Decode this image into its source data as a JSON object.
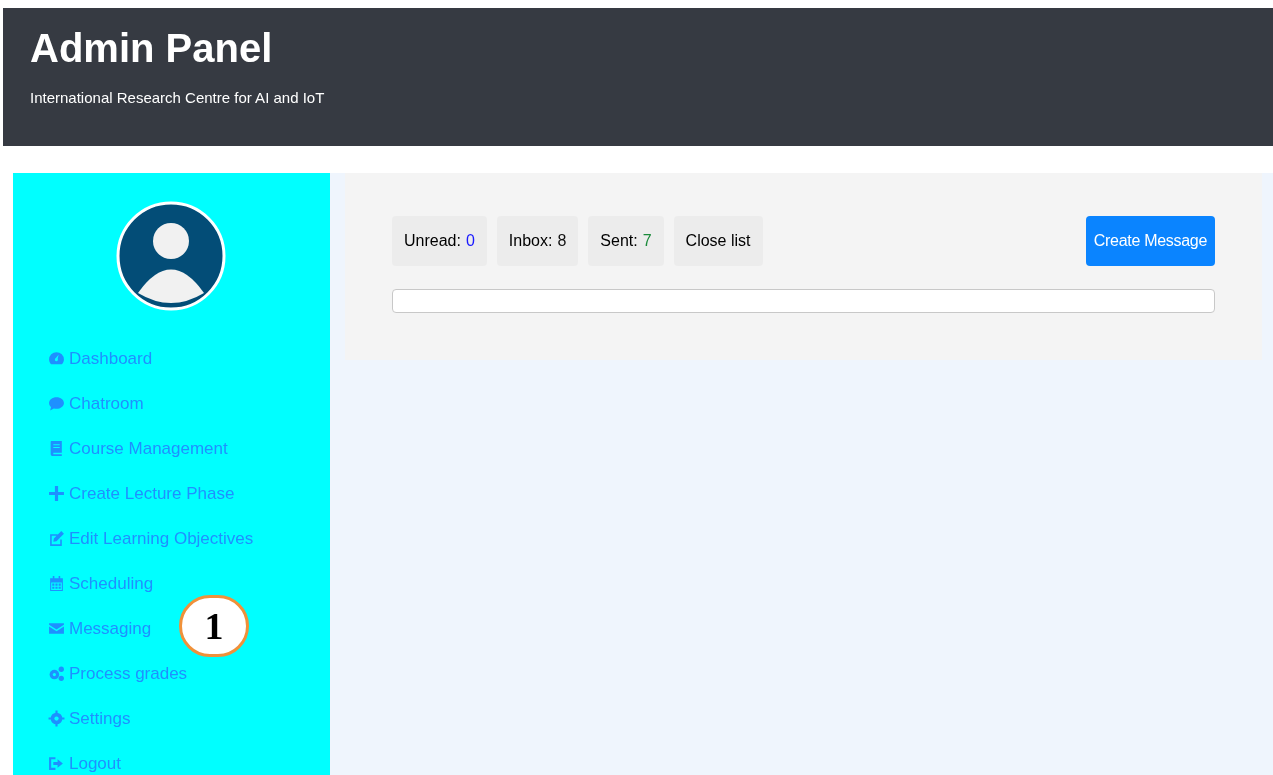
{
  "header": {
    "title": "Admin Panel",
    "subtitle": "International Research Centre for AI and IoT"
  },
  "sidebar": {
    "items": [
      {
        "label": "Dashboard"
      },
      {
        "label": "Chatroom"
      },
      {
        "label": "Course Management"
      },
      {
        "label": "Create Lecture Phase"
      },
      {
        "label": "Edit Learning Objectives"
      },
      {
        "label": "Scheduling"
      },
      {
        "label": "Messaging"
      },
      {
        "label": "Process grades"
      },
      {
        "label": "Settings"
      },
      {
        "label": "Logout"
      }
    ]
  },
  "callout": {
    "label": "1"
  },
  "counters": [
    {
      "label": "Unread:",
      "count": "0",
      "color": "#1a1aff"
    },
    {
      "label": "Inbox:",
      "count": "8",
      "color": "#111111"
    },
    {
      "label": "Sent:",
      "count": "7",
      "color": "#1a8a3a"
    }
  ],
  "close_button": "Close list",
  "create_button": "Create Message"
}
